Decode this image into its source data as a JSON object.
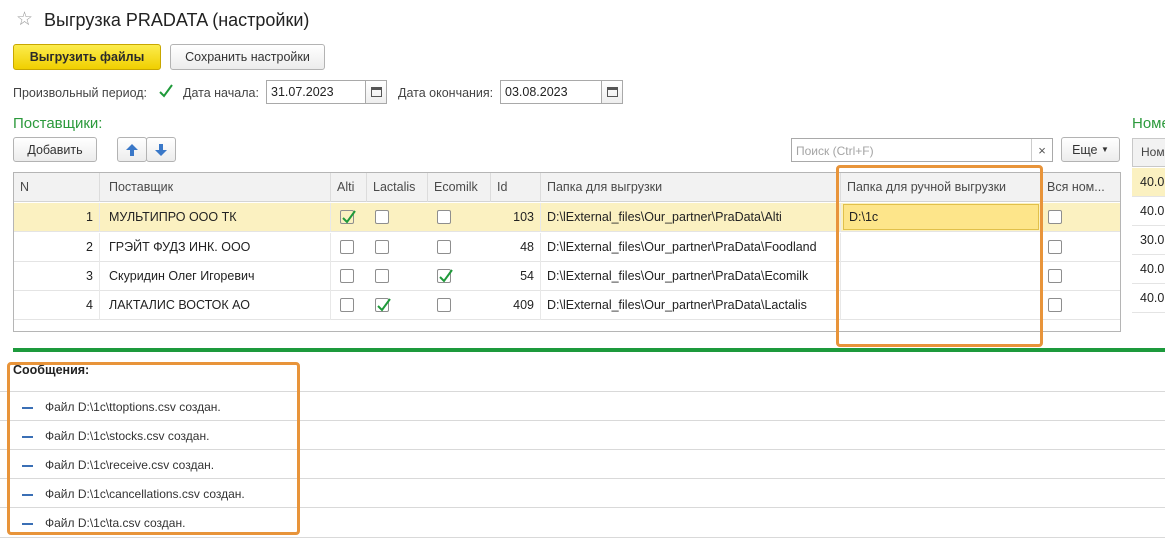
{
  "window": {
    "title": "Выгрузка PRADATA (настройки)"
  },
  "toolbar": {
    "export_label": "Выгрузить файлы",
    "save_label": "Сохранить настройки"
  },
  "period": {
    "custom_label": "Произвольный период:",
    "custom_checked": true,
    "start_label": "Дата начала:",
    "start_value": "31.07.2023",
    "end_label": "Дата окончания:",
    "end_value": "03.08.2023"
  },
  "suppliers": {
    "title": "Поставщики:",
    "add_label": "Добавить",
    "search_placeholder": "Поиск (Ctrl+F)",
    "search_clear": "×",
    "more_label": "Еще",
    "columns": [
      "N",
      "Поставщик",
      "Alti",
      "Lactalis",
      "Ecomilk",
      "Id",
      "Папка для выгрузки",
      "Папка для ручной выгрузки",
      "Вся ном..."
    ],
    "rows": [
      {
        "n": "1",
        "name": "МУЛЬТИПРО ООО ТК",
        "alti": true,
        "lactalis": false,
        "ecomilk": false,
        "id": "103",
        "folder": "D:\\lExternal_files\\Our_partner\\PraData\\Alti",
        "manual_folder": "D:\\1c",
        "all": false
      },
      {
        "n": "2",
        "name": "ГРЭЙТ ФУДЗ ИНК. ООО",
        "alti": false,
        "lactalis": false,
        "ecomilk": false,
        "id": "48",
        "folder": "D:\\lExternal_files\\Our_partner\\PraData\\Foodland",
        "manual_folder": "",
        "all": false
      },
      {
        "n": "3",
        "name": "Скуридин Олег Игоревич",
        "alti": false,
        "lactalis": false,
        "ecomilk": true,
        "id": "54",
        "folder": "D:\\lExternal_files\\Our_partner\\PraData\\Ecomilk",
        "manual_folder": "",
        "all": false
      },
      {
        "n": "4",
        "name": "ЛАКТАЛИС ВОСТОК АО",
        "alti": false,
        "lactalis": true,
        "ecomilk": false,
        "id": "409",
        "folder": "D:\\lExternal_files\\Our_partner\\PraData\\Lactalis",
        "manual_folder": "",
        "all": false
      }
    ]
  },
  "right_panel": {
    "title": "Номенклатура",
    "header": "Ном",
    "values": [
      "40.0",
      "40.0",
      "30.0",
      "40.0",
      "40.0"
    ]
  },
  "messages": {
    "title": "Сообщения:",
    "items": [
      "Файл D:\\1c\\ttoptions.csv создан.",
      "Файл D:\\1c\\stocks.csv создан.",
      "Файл D:\\1c\\receive.csv создан.",
      "Файл D:\\1c\\cancellations.csv создан.",
      "Файл D:\\1c\\ta.csv создан."
    ]
  },
  "colors": {
    "accent_green": "#2c9a3c",
    "primary_button": "#f5d90a",
    "highlight_box": "#e8943a",
    "selected_row": "#fbf1c1"
  }
}
